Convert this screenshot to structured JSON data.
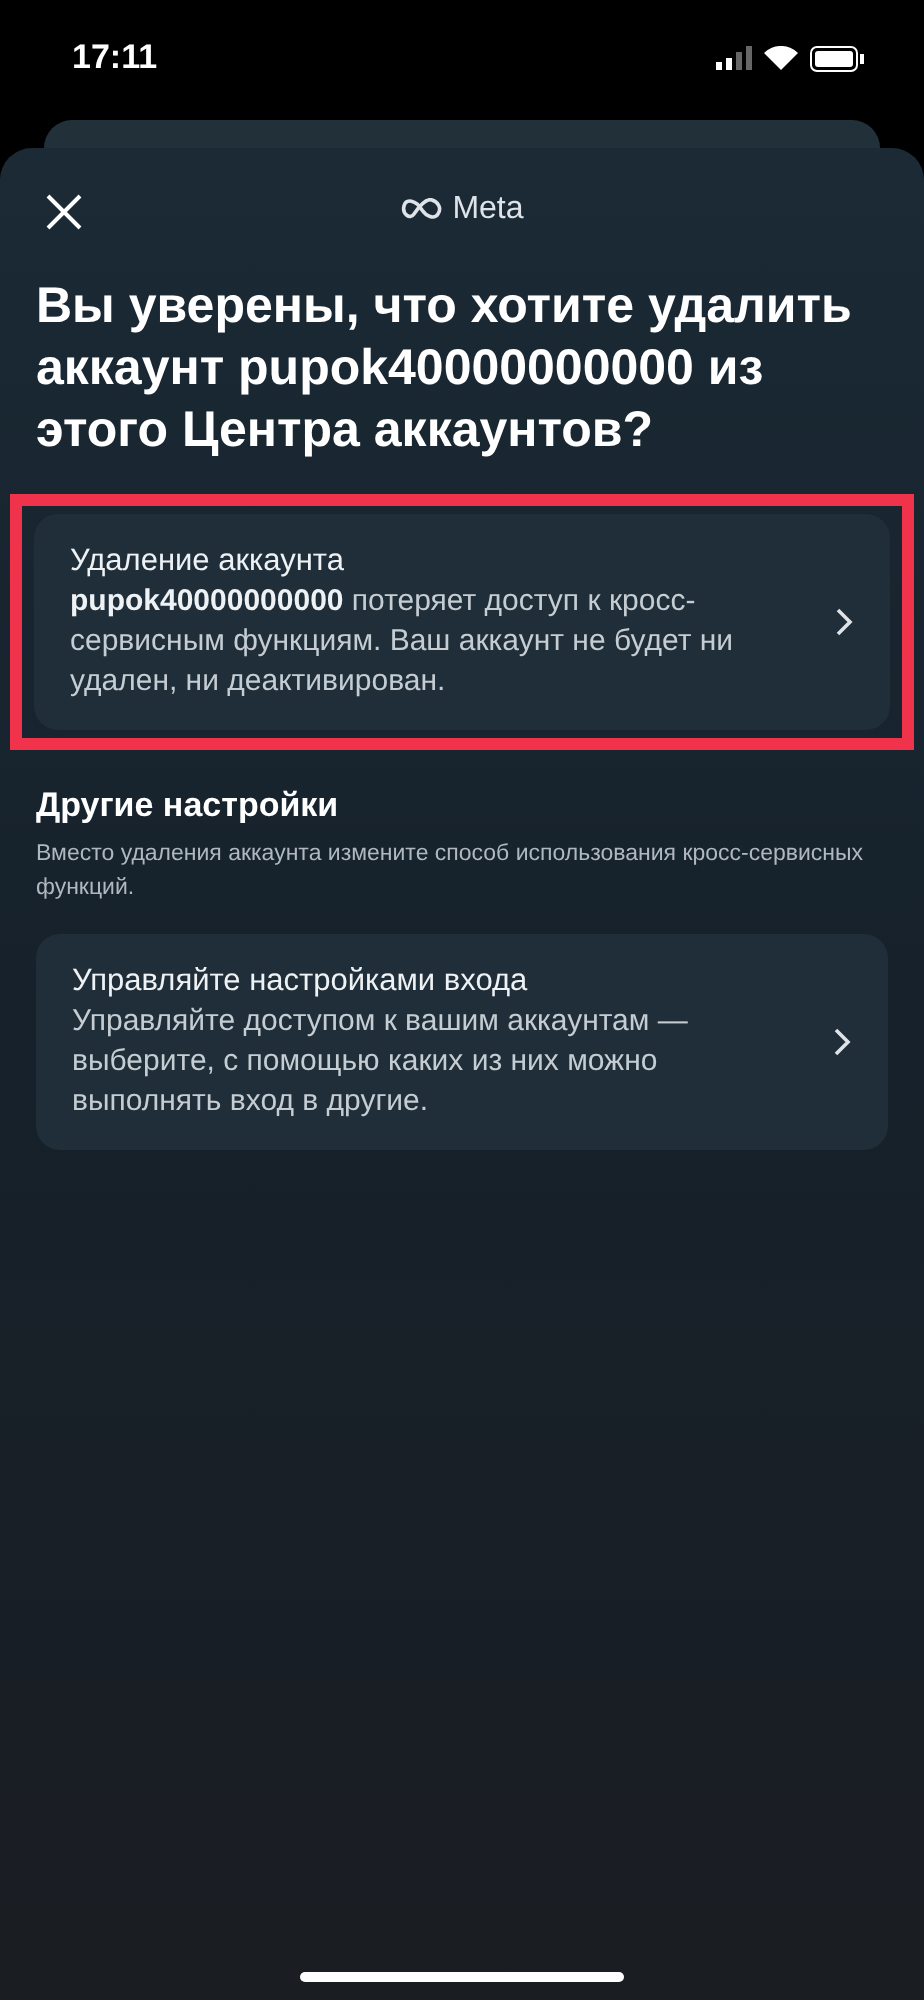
{
  "status_bar": {
    "time": "17:11"
  },
  "header": {
    "brand": "Meta"
  },
  "title": "Вы уверены, что хотите удалить аккаунт pupok40000000000 из этого Центра аккаунтов?",
  "cards": [
    {
      "title": "Удаление аккаунта",
      "description": "**pupok40000000000** потеряет доступ к кросс-сервисным функциям. Ваш аккаунт не будет ни удален, ни деактивирован.",
      "highlighted": true
    }
  ],
  "other_settings": {
    "heading": "Другие настройки",
    "subtitle": "Вместо удаления аккаунта измените способ использования кросс-сервисных функций.",
    "cards": [
      {
        "title": "Управляйте настройками входа",
        "description": "Управляйте доступом к вашим аккаунтам — выберите, с помощью каких из них можно выполнять вход в другие.",
        "highlighted": false
      }
    ]
  }
}
